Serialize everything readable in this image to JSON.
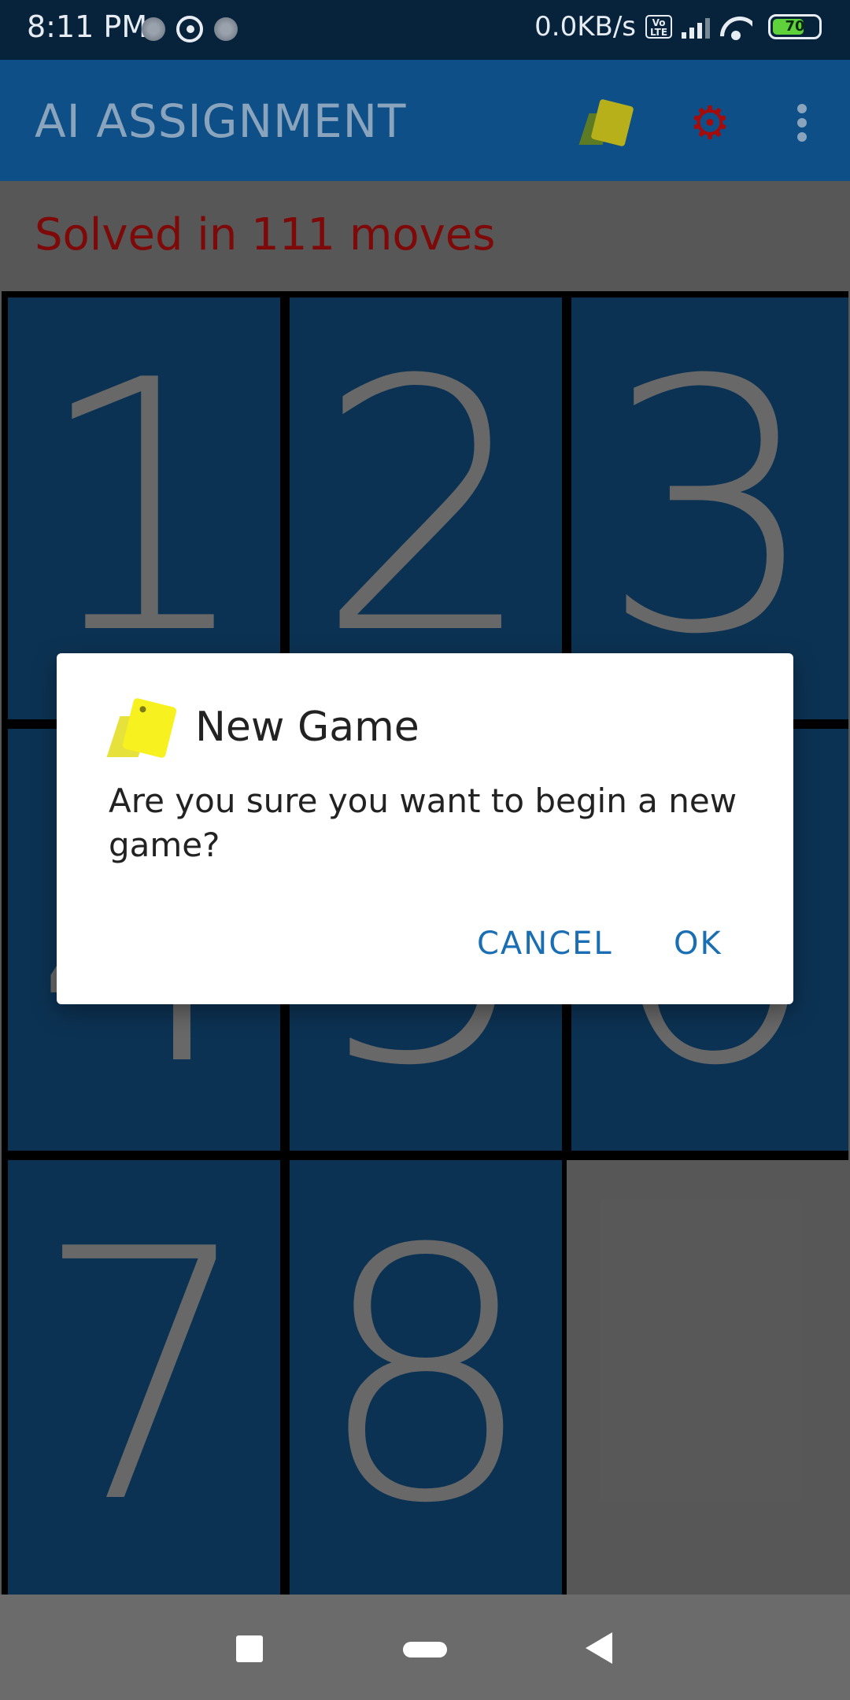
{
  "status_bar": {
    "time": "8:11 PM",
    "speed": "0.0KB/s",
    "volte": "Vo LTE",
    "battery": "70",
    "battery_level": 0.7,
    "icons": [
      "notification-dot-icon",
      "whatsapp-icon",
      "notification-dot-icon",
      "volte-icon",
      "signal-icon",
      "wifi-icon",
      "battery-icon"
    ]
  },
  "app_bar": {
    "title": "AI ASSIGNMENT",
    "actions": [
      "cards-icon",
      "gear-icon",
      "more-vert-icon"
    ]
  },
  "game": {
    "message": "Solved in 111 moves",
    "tiles": [
      "1",
      "2",
      "3",
      "4",
      "5",
      "6",
      "7",
      "8",
      ""
    ]
  },
  "dialog": {
    "title": "New Game",
    "message": "Are you sure you want to begin a new game?",
    "cancel_label": "CANCEL",
    "ok_label": "OK"
  },
  "colors": {
    "status_bar": "#07223b",
    "app_bar": "#0d4f86",
    "tile": "#0f3e66",
    "tile_text": "#7f7f7f",
    "message_text": "#9a0b0b",
    "dialog_button": "#1a6fb4",
    "background": "#6b6b6b"
  }
}
